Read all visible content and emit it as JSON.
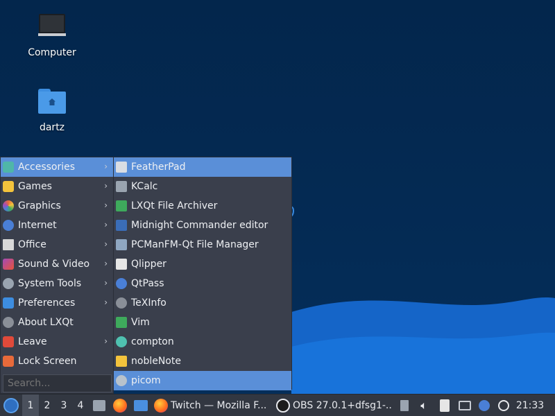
{
  "desktop": {
    "icons": [
      {
        "label": "Computer"
      },
      {
        "label": "dartz"
      }
    ]
  },
  "menu": {
    "categories": [
      {
        "label": "Accessories",
        "icon": "accessories-icon",
        "color": "#4fb6a8"
      },
      {
        "label": "Games",
        "icon": "games-icon",
        "color": "#f3c33c"
      },
      {
        "label": "Graphics",
        "icon": "graphics-icon",
        "color": "#e86a3a"
      },
      {
        "label": "Internet",
        "icon": "internet-icon",
        "color": "#4a7fd6"
      },
      {
        "label": "Office",
        "icon": "office-icon",
        "color": "#d8d8d8"
      },
      {
        "label": "Sound & Video",
        "icon": "sound-video-icon",
        "color": "#a34bb8"
      },
      {
        "label": "System Tools",
        "icon": "system-tools-icon",
        "color": "#9aa4b0"
      },
      {
        "label": "Preferences",
        "icon": "preferences-icon",
        "color": "#3d8de0"
      },
      {
        "label": "About LXQt",
        "icon": "about-icon",
        "color": "#8a8f98"
      },
      {
        "label": "Leave",
        "icon": "leave-icon",
        "color": "#e04a3a"
      },
      {
        "label": "Lock Screen",
        "icon": "lock-icon",
        "color": "#e86a3a"
      }
    ],
    "search_placeholder": "Search...",
    "accessories": [
      {
        "label": "FeatherPad",
        "icon": "featherpad-icon",
        "color": "#d9dde3"
      },
      {
        "label": "KCalc",
        "icon": "kcalc-icon",
        "color": "#9aa4b0"
      },
      {
        "label": "LXQt File Archiver",
        "icon": "archiver-icon",
        "color": "#3eaa5c"
      },
      {
        "label": "Midnight Commander editor",
        "icon": "mc-icon",
        "color": "#3a6db8"
      },
      {
        "label": "PCManFM-Qt File Manager",
        "icon": "file-manager-icon",
        "color": "#8fa7c2"
      },
      {
        "label": "Qlipper",
        "icon": "qlipper-icon",
        "color": "#e6e6e6"
      },
      {
        "label": "QtPass",
        "icon": "qtpass-icon",
        "color": "#4a7fd6"
      },
      {
        "label": "TeXInfo",
        "icon": "texinfo-icon",
        "color": "#8a8f98"
      },
      {
        "label": "Vim",
        "icon": "vim-icon",
        "color": "#3eaa5c"
      },
      {
        "label": "compton",
        "icon": "compton-icon",
        "color": "#4fc1b0"
      },
      {
        "label": "nobleNote",
        "icon": "noblenote-icon",
        "color": "#f3c33c"
      },
      {
        "label": "picom",
        "icon": "picom-icon",
        "color": "#b8c2cc"
      }
    ]
  },
  "taskbar": {
    "desktops": [
      "1",
      "2",
      "3",
      "4"
    ],
    "tasks": [
      {
        "label": "Twitch — Mozilla F..."
      },
      {
        "label": "OBS 27.0.1+dfsg1-..."
      }
    ],
    "clock": "21:33"
  }
}
